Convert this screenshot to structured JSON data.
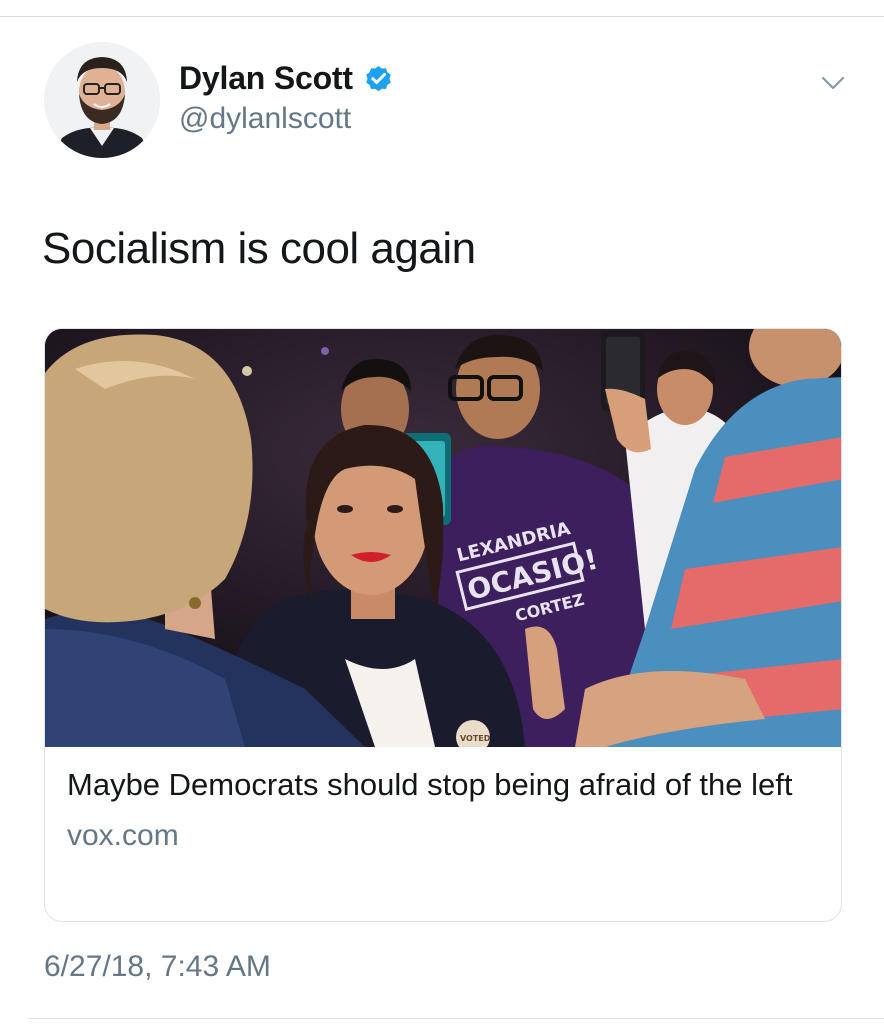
{
  "user": {
    "display_name": "Dylan Scott",
    "handle": "@dylanlscott",
    "verified": true,
    "avatar_icon": "profile-photo",
    "verified_icon": "verified-badge-icon"
  },
  "tweet": {
    "text": "Socialism is cool again",
    "timestamp": "6/27/18, 7:43 AM"
  },
  "card": {
    "title": "Maybe Democrats should stop being afraid of the left",
    "domain": "vox.com",
    "image_signs": {
      "line1": "LEXANDRIA",
      "line2": "OCASIO!",
      "line3": "CORTEZ"
    },
    "button_text": "VOTED"
  },
  "colors": {
    "text_primary": "#14171a",
    "text_secondary": "#657786",
    "verified_blue": "#1da1f2",
    "border": "#dfe3e6"
  }
}
